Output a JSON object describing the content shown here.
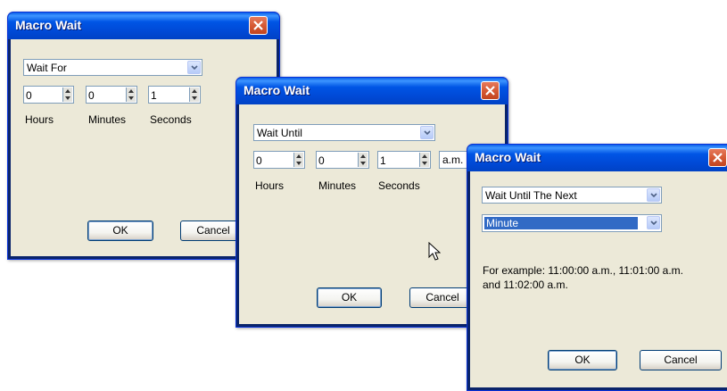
{
  "dialogs": [
    {
      "title": "Macro Wait",
      "mode": "Wait For",
      "hours": "0",
      "minutes": "0",
      "seconds": "1",
      "labels": {
        "hours": "Hours",
        "minutes": "Minutes",
        "seconds": "Seconds"
      },
      "ok": "OK",
      "cancel": "Cancel"
    },
    {
      "title": "Macro Wait",
      "mode": "Wait Until",
      "hours": "0",
      "minutes": "0",
      "seconds": "1",
      "ampm": "a.m.",
      "labels": {
        "hours": "Hours",
        "minutes": "Minutes",
        "seconds": "Seconds"
      },
      "ok": "OK",
      "cancel": "Cancel"
    },
    {
      "title": "Macro Wait",
      "mode": "Wait Until The Next",
      "unit": "Minute",
      "example": "For example: 11:00:00 a.m., 11:01:00 a.m. and 11:02:00 a.m.",
      "ok": "OK",
      "cancel": "Cancel"
    }
  ],
  "colors": {
    "titlebar": "#0055e5",
    "close": "#d65a35",
    "body": "#ece9d8",
    "selection": "#316ac5"
  }
}
